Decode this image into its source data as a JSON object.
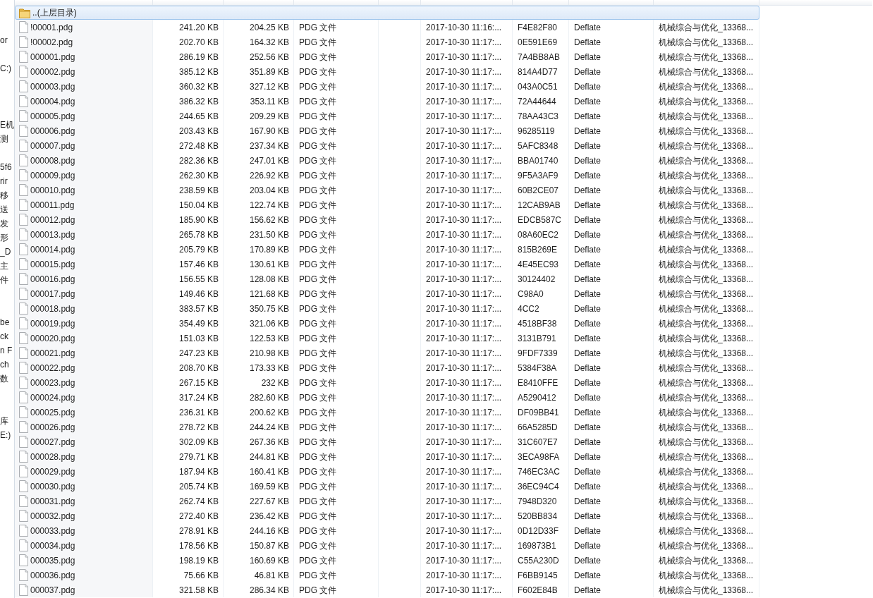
{
  "sidebar": {
    "groups": [
      [
        "or"
      ],
      [
        "C:)"
      ],
      [
        "E机",
        "测"
      ],
      [
        "5f6",
        "rir",
        "移",
        "送",
        "发",
        "形",
        "_D",
        "主",
        "件"
      ],
      [
        "be",
        "ck",
        "n F",
        "ch",
        "数"
      ],
      [
        "库",
        "E:)"
      ]
    ]
  },
  "file_list": {
    "rows": [
      {
        "kind": "folder",
        "name": "..(上层目录)",
        "selected": true
      },
      {
        "kind": "file",
        "name": "!00001.pdg",
        "size": "241.20 KB",
        "packed": "204.25 KB",
        "type": "PDG 文件",
        "modified": "2017-10-30 11:16:...",
        "crc": "F4E82F80",
        "method": "Deflate",
        "folder": "机械综合与优化_13368...",
        "selected": false
      },
      {
        "kind": "file",
        "name": "!00002.pdg",
        "size": "202.70 KB",
        "packed": "164.32 KB",
        "type": "PDG 文件",
        "modified": "2017-10-30 11:17:...",
        "crc": "0E591E69",
        "method": "Deflate",
        "folder": "机械综合与优化_13368...",
        "selected": false
      },
      {
        "kind": "file",
        "name": "000001.pdg",
        "size": "286.19 KB",
        "packed": "252.56 KB",
        "type": "PDG 文件",
        "modified": "2017-10-30 11:17:...",
        "crc": "7A4BB8AB",
        "method": "Deflate",
        "folder": "机械综合与优化_13368...",
        "selected": false
      },
      {
        "kind": "file",
        "name": "000002.pdg",
        "size": "385.12 KB",
        "packed": "351.89 KB",
        "type": "PDG 文件",
        "modified": "2017-10-30 11:17:...",
        "crc": "814A4D77",
        "method": "Deflate",
        "folder": "机械综合与优化_13368...",
        "selected": false
      },
      {
        "kind": "file",
        "name": "000003.pdg",
        "size": "360.32 KB",
        "packed": "327.12 KB",
        "type": "PDG 文件",
        "modified": "2017-10-30 11:17:...",
        "crc": "043A0C51",
        "method": "Deflate",
        "folder": "机械综合与优化_13368...",
        "selected": false
      },
      {
        "kind": "file",
        "name": "000004.pdg",
        "size": "386.32 KB",
        "packed": "353.11 KB",
        "type": "PDG 文件",
        "modified": "2017-10-30 11:17:...",
        "crc": "72A44644",
        "method": "Deflate",
        "folder": "机械综合与优化_13368...",
        "selected": false
      },
      {
        "kind": "file",
        "name": "000005.pdg",
        "size": "244.65 KB",
        "packed": "209.29 KB",
        "type": "PDG 文件",
        "modified": "2017-10-30 11:17:...",
        "crc": "78AA43C3",
        "method": "Deflate",
        "folder": "机械综合与优化_13368...",
        "selected": false
      },
      {
        "kind": "file",
        "name": "000006.pdg",
        "size": "203.43 KB",
        "packed": "167.90 KB",
        "type": "PDG 文件",
        "modified": "2017-10-30 11:17:...",
        "crc": "96285119",
        "method": "Deflate",
        "folder": "机械综合与优化_13368...",
        "selected": false
      },
      {
        "kind": "file",
        "name": "000007.pdg",
        "size": "272.48 KB",
        "packed": "237.34 KB",
        "type": "PDG 文件",
        "modified": "2017-10-30 11:17:...",
        "crc": "5AFC8348",
        "method": "Deflate",
        "folder": "机械综合与优化_13368...",
        "selected": false
      },
      {
        "kind": "file",
        "name": "000008.pdg",
        "size": "282.36 KB",
        "packed": "247.01 KB",
        "type": "PDG 文件",
        "modified": "2017-10-30 11:17:...",
        "crc": "BBA01740",
        "method": "Deflate",
        "folder": "机械综合与优化_13368...",
        "selected": false
      },
      {
        "kind": "file",
        "name": "000009.pdg",
        "size": "262.30 KB",
        "packed": "226.92 KB",
        "type": "PDG 文件",
        "modified": "2017-10-30 11:17:...",
        "crc": "9F5A3AF9",
        "method": "Deflate",
        "folder": "机械综合与优化_13368...",
        "selected": false
      },
      {
        "kind": "file",
        "name": "000010.pdg",
        "size": "238.59 KB",
        "packed": "203.04 KB",
        "type": "PDG 文件",
        "modified": "2017-10-30 11:17:...",
        "crc": "60B2CE07",
        "method": "Deflate",
        "folder": "机械综合与优化_13368...",
        "selected": false
      },
      {
        "kind": "file",
        "name": "000011.pdg",
        "size": "150.04 KB",
        "packed": "122.74 KB",
        "type": "PDG 文件",
        "modified": "2017-10-30 11:17:...",
        "crc": "12CAB9AB",
        "method": "Deflate",
        "folder": "机械综合与优化_13368...",
        "selected": false
      },
      {
        "kind": "file",
        "name": "000012.pdg",
        "size": "185.90 KB",
        "packed": "156.62 KB",
        "type": "PDG 文件",
        "modified": "2017-10-30 11:17:...",
        "crc": "EDCB587C",
        "method": "Deflate",
        "folder": "机械综合与优化_13368...",
        "selected": false
      },
      {
        "kind": "file",
        "name": "000013.pdg",
        "size": "265.78 KB",
        "packed": "231.50 KB",
        "type": "PDG 文件",
        "modified": "2017-10-30 11:17:...",
        "crc": "08A60EC2",
        "method": "Deflate",
        "folder": "机械综合与优化_13368...",
        "selected": false
      },
      {
        "kind": "file",
        "name": "000014.pdg",
        "size": "205.79 KB",
        "packed": "170.89 KB",
        "type": "PDG 文件",
        "modified": "2017-10-30 11:17:...",
        "crc": "815B269E",
        "method": "Deflate",
        "folder": "机械综合与优化_13368...",
        "selected": false
      },
      {
        "kind": "file",
        "name": "000015.pdg",
        "size": "157.46 KB",
        "packed": "130.61 KB",
        "type": "PDG 文件",
        "modified": "2017-10-30 11:17:...",
        "crc": "4E45EC93",
        "method": "Deflate",
        "folder": "机械综合与优化_13368...",
        "selected": false
      },
      {
        "kind": "file",
        "name": "000016.pdg",
        "size": "156.55 KB",
        "packed": "128.08 KB",
        "type": "PDG 文件",
        "modified": "2017-10-30 11:17:...",
        "crc": "30124402",
        "method": "Deflate",
        "folder": "机械综合与优化_13368...",
        "selected": false
      },
      {
        "kind": "file",
        "name": "000017.pdg",
        "size": "149.46 KB",
        "packed": "121.68 KB",
        "type": "PDG 文件",
        "modified": "2017-10-30 11:17:...",
        "crc": "C98A0",
        "method": "Deflate",
        "folder": "机械综合与优化_13368...",
        "selected": false
      },
      {
        "kind": "file",
        "name": "000018.pdg",
        "size": "383.57 KB",
        "packed": "350.75 KB",
        "type": "PDG 文件",
        "modified": "2017-10-30 11:17:...",
        "crc": "4CC2",
        "method": "Deflate",
        "folder": "机械综合与优化_13368...",
        "selected": false
      },
      {
        "kind": "file",
        "name": "000019.pdg",
        "size": "354.49 KB",
        "packed": "321.06 KB",
        "type": "PDG 文件",
        "modified": "2017-10-30 11:17:...",
        "crc": "4518BF38",
        "method": "Deflate",
        "folder": "机械综合与优化_13368...",
        "selected": false
      },
      {
        "kind": "file",
        "name": "000020.pdg",
        "size": "151.03 KB",
        "packed": "122.53 KB",
        "type": "PDG 文件",
        "modified": "2017-10-30 11:17:...",
        "crc": "3131B791",
        "method": "Deflate",
        "folder": "机械综合与优化_13368...",
        "selected": false
      },
      {
        "kind": "file",
        "name": "000021.pdg",
        "size": "247.23 KB",
        "packed": "210.98 KB",
        "type": "PDG 文件",
        "modified": "2017-10-30 11:17:...",
        "crc": "9FDF7339",
        "method": "Deflate",
        "folder": "机械综合与优化_13368...",
        "selected": false
      },
      {
        "kind": "file",
        "name": "000022.pdg",
        "size": "208.70 KB",
        "packed": "173.33 KB",
        "type": "PDG 文件",
        "modified": "2017-10-30 11:17:...",
        "crc": "5384F38A",
        "method": "Deflate",
        "folder": "机械综合与优化_13368...",
        "selected": false
      },
      {
        "kind": "file",
        "name": "000023.pdg",
        "size": "267.15 KB",
        "packed": "232 KB",
        "type": "PDG 文件",
        "modified": "2017-10-30 11:17:...",
        "crc": "E8410FFE",
        "method": "Deflate",
        "folder": "机械综合与优化_13368...",
        "selected": false
      },
      {
        "kind": "file",
        "name": "000024.pdg",
        "size": "317.24 KB",
        "packed": "282.60 KB",
        "type": "PDG 文件",
        "modified": "2017-10-30 11:17:...",
        "crc": "A5290412",
        "method": "Deflate",
        "folder": "机械综合与优化_13368...",
        "selected": false
      },
      {
        "kind": "file",
        "name": "000025.pdg",
        "size": "236.31 KB",
        "packed": "200.62 KB",
        "type": "PDG 文件",
        "modified": "2017-10-30 11:17:...",
        "crc": "DF09BB41",
        "method": "Deflate",
        "folder": "机械综合与优化_13368...",
        "selected": false
      },
      {
        "kind": "file",
        "name": "000026.pdg",
        "size": "278.72 KB",
        "packed": "244.24 KB",
        "type": "PDG 文件",
        "modified": "2017-10-30 11:17:...",
        "crc": "66A5285D",
        "method": "Deflate",
        "folder": "机械综合与优化_13368...",
        "selected": false
      },
      {
        "kind": "file",
        "name": "000027.pdg",
        "size": "302.09 KB",
        "packed": "267.36 KB",
        "type": "PDG 文件",
        "modified": "2017-10-30 11:17:...",
        "crc": "31C607E7",
        "method": "Deflate",
        "folder": "机械综合与优化_13368...",
        "selected": false
      },
      {
        "kind": "file",
        "name": "000028.pdg",
        "size": "279.71 KB",
        "packed": "244.81 KB",
        "type": "PDG 文件",
        "modified": "2017-10-30 11:17:...",
        "crc": "3ECA98FA",
        "method": "Deflate",
        "folder": "机械综合与优化_13368...",
        "selected": false
      },
      {
        "kind": "file",
        "name": "000029.pdg",
        "size": "187.94 KB",
        "packed": "160.41 KB",
        "type": "PDG 文件",
        "modified": "2017-10-30 11:17:...",
        "crc": "746EC3AC",
        "method": "Deflate",
        "folder": "机械综合与优化_13368...",
        "selected": false
      },
      {
        "kind": "file",
        "name": "000030.pdg",
        "size": "205.74 KB",
        "packed": "169.59 KB",
        "type": "PDG 文件",
        "modified": "2017-10-30 11:17:...",
        "crc": "36EC94C4",
        "method": "Deflate",
        "folder": "机械综合与优化_13368...",
        "selected": false
      },
      {
        "kind": "file",
        "name": "000031.pdg",
        "size": "262.74 KB",
        "packed": "227.67 KB",
        "type": "PDG 文件",
        "modified": "2017-10-30 11:17:...",
        "crc": "7948D320",
        "method": "Deflate",
        "folder": "机械综合与优化_13368...",
        "selected": false
      },
      {
        "kind": "file",
        "name": "000032.pdg",
        "size": "272.40 KB",
        "packed": "236.42 KB",
        "type": "PDG 文件",
        "modified": "2017-10-30 11:17:...",
        "crc": "520BB834",
        "method": "Deflate",
        "folder": "机械综合与优化_13368...",
        "selected": false
      },
      {
        "kind": "file",
        "name": "000033.pdg",
        "size": "278.91 KB",
        "packed": "244.16 KB",
        "type": "PDG 文件",
        "modified": "2017-10-30 11:17:...",
        "crc": "0D12D33F",
        "method": "Deflate",
        "folder": "机械综合与优化_13368...",
        "selected": false
      },
      {
        "kind": "file",
        "name": "000034.pdg",
        "size": "178.56 KB",
        "packed": "150.87 KB",
        "type": "PDG 文件",
        "modified": "2017-10-30 11:17:...",
        "crc": "169873B1",
        "method": "Deflate",
        "folder": "机械综合与优化_13368...",
        "selected": false
      },
      {
        "kind": "file",
        "name": "000035.pdg",
        "size": "198.19 KB",
        "packed": "160.69 KB",
        "type": "PDG 文件",
        "modified": "2017-10-30 11:17:...",
        "crc": "C55A230D",
        "method": "Deflate",
        "folder": "机械综合与优化_13368...",
        "selected": false
      },
      {
        "kind": "file",
        "name": "000036.pdg",
        "size": "75.66 KB",
        "packed": "46.81 KB",
        "type": "PDG 文件",
        "modified": "2017-10-30 11:17:...",
        "crc": "F6BB9145",
        "method": "Deflate",
        "folder": "机械综合与优化_13368...",
        "selected": false
      },
      {
        "kind": "file",
        "name": "000037.pdg",
        "size": "321.58 KB",
        "packed": "286.34 KB",
        "type": "PDG 文件",
        "modified": "2017-10-30 11:17:...",
        "crc": "F602E84B",
        "method": "Deflate",
        "folder": "机械综合与优化_13368...",
        "selected": false
      }
    ]
  }
}
